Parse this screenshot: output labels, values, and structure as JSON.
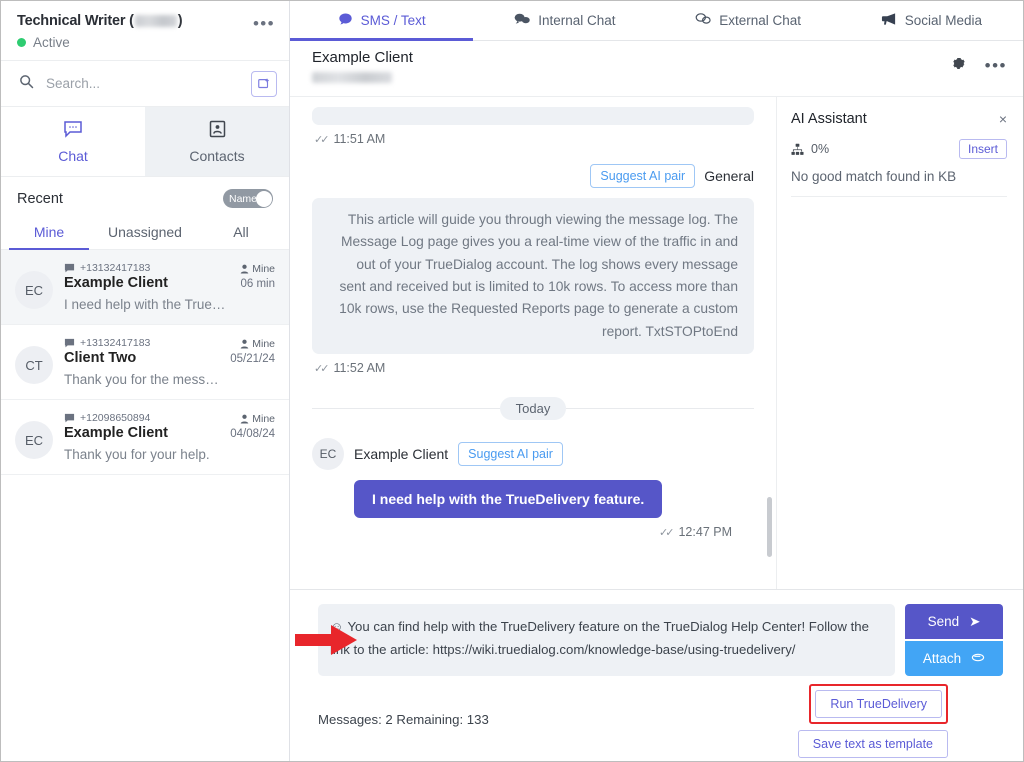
{
  "sidebar": {
    "user": {
      "name_prefix": "Technical Writer (",
      "name_suffix": ")",
      "status": "Active",
      "more_icon": "•••"
    },
    "search": {
      "placeholder": "Search...",
      "value": ""
    },
    "new_conversation_icon": "new-message-icon",
    "tabs": [
      {
        "label": "Chat",
        "icon": "chat-bubble-icon",
        "active": true
      },
      {
        "label": "Contacts",
        "icon": "contact-card-icon",
        "active": false
      }
    ],
    "recent_label": "Recent",
    "name_toggle": {
      "label": "Name",
      "on": true
    },
    "filters": [
      {
        "label": "Mine",
        "active": true
      },
      {
        "label": "Unassigned",
        "active": false
      },
      {
        "label": "All",
        "active": false
      }
    ],
    "conversations": [
      {
        "initials": "EC",
        "phone": "+13132417183",
        "name": "Example Client",
        "snippet": "I need help with the TrueDeliv...",
        "owner": "Mine",
        "time": "06 min",
        "selected": true
      },
      {
        "initials": "CT",
        "phone": "+13132417183",
        "name": "Client Two",
        "snippet": "Thank you for the message!",
        "owner": "Mine",
        "time": "05/21/24",
        "selected": false
      },
      {
        "initials": "EC",
        "phone": "+12098650894",
        "name": "Example Client",
        "snippet": "Thank you for your help.",
        "owner": "Mine",
        "time": "04/08/24",
        "selected": false
      }
    ]
  },
  "main": {
    "tabs": [
      {
        "label": "SMS / Text",
        "icon": "sms-bubble-icon",
        "active": true
      },
      {
        "label": "Internal Chat",
        "icon": "two-bubbles-icon",
        "active": false
      },
      {
        "label": "External Chat",
        "icon": "chat-outline-icon",
        "active": false
      },
      {
        "label": "Social Media",
        "icon": "megaphone-icon",
        "active": false
      }
    ],
    "conversation_header": {
      "name": "Example Client",
      "phone_redacted": true,
      "settings_icon": "gear-icon",
      "more_icon": "•••"
    },
    "thread": {
      "messages": [
        {
          "type": "outgoing-stub",
          "text": "",
          "time": "11:51 AM"
        },
        {
          "type": "outgoing",
          "text": "This article will guide you through viewing the message log. The Message Log page gives you a real-time view of the traffic in and out of your TrueDialog account. The log shows every message sent and received but is limited to 10k rows. To access more than 10k rows, use the Requested Reports page to generate a custom report. TxtSTOPtoEnd",
          "time": "11:52 AM",
          "suggest_button": "Suggest AI pair",
          "category": "General"
        }
      ],
      "day_separator": "Today",
      "incoming": {
        "initials": "EC",
        "sender": "Example Client",
        "suggest_button": "Suggest AI pair",
        "text": "I need help with the TrueDelivery feature.",
        "time": "12:47 PM"
      }
    },
    "ai_assistant": {
      "title": "AI Assistant",
      "close_icon": "×",
      "score": "0%",
      "score_icon": "sitemap-icon",
      "insert_label": "Insert",
      "result": "No good match found in KB"
    },
    "compose": {
      "smiley_icon": "smiley-icon",
      "text": "You can find help with the TrueDelivery feature on the TrueDialog Help Center! Follow the link to the article: https://wiki.truedialog.com/knowledge-base/using-truedelivery/",
      "send_label": "Send",
      "send_icon": "paper-plane-icon",
      "attach_label": "Attach",
      "attach_icon": "paperclip-icon",
      "counter": "Messages: 2 Remaining: 133",
      "run_truedelivery_label": "Run TrueDelivery",
      "save_template_label": "Save text as template"
    }
  },
  "annotations": {
    "arrow_color": "#e8262b",
    "highlight_color": "#e8262b"
  }
}
